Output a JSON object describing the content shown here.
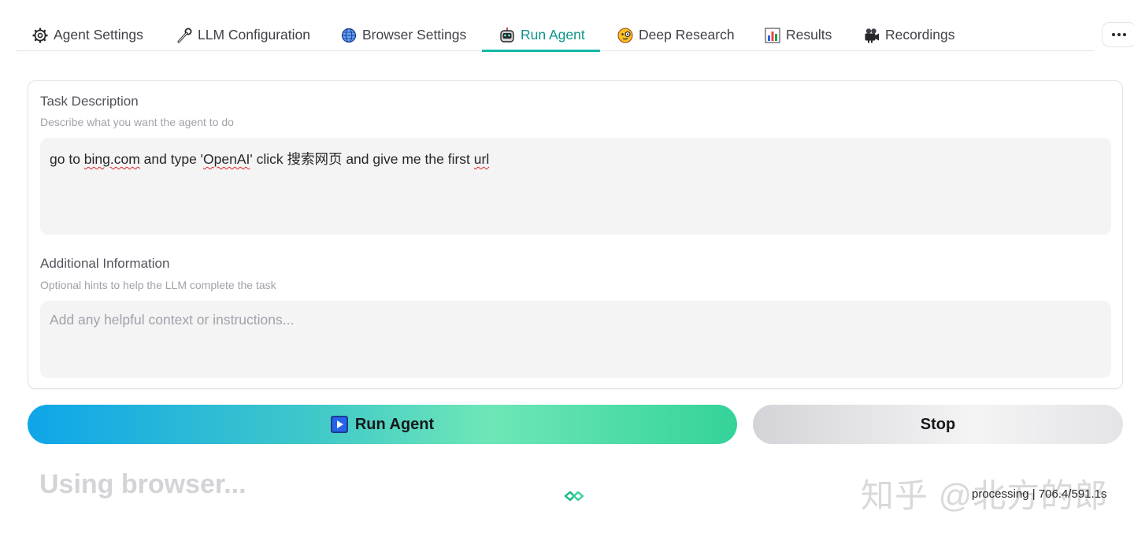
{
  "tabs": [
    {
      "label": "Agent Settings",
      "icon": "gear-icon"
    },
    {
      "label": "LLM Configuration",
      "icon": "wrench-icon"
    },
    {
      "label": "Browser Settings",
      "icon": "globe-icon"
    },
    {
      "label": "Run Agent",
      "icon": "robot-icon"
    },
    {
      "label": "Deep Research",
      "icon": "monocle-face-icon"
    },
    {
      "label": "Results",
      "icon": "bar-chart-icon"
    },
    {
      "label": "Recordings",
      "icon": "movie-camera-icon"
    }
  ],
  "active_tab": "Run Agent",
  "task": {
    "label": "Task Description",
    "info": "Describe what you want the agent to do",
    "value_parts": [
      "go to ",
      "bing.com",
      " and type '",
      "OpenAI",
      "' click 搜索网页 and give me the first ",
      "url"
    ]
  },
  "additional": {
    "label": "Additional Information",
    "info": "Optional hints to help the LLM complete the task",
    "placeholder": "Add any helpful context or instructions..."
  },
  "buttons": {
    "run": "Run Agent",
    "stop": "Stop"
  },
  "status": {
    "title": "Using browser...",
    "timer": "processing | 706.4/591.1s"
  },
  "watermark": "知乎 @北方的郎",
  "colors": {
    "accent": "#14b8a6",
    "active_tab_text": "#0d9488"
  }
}
